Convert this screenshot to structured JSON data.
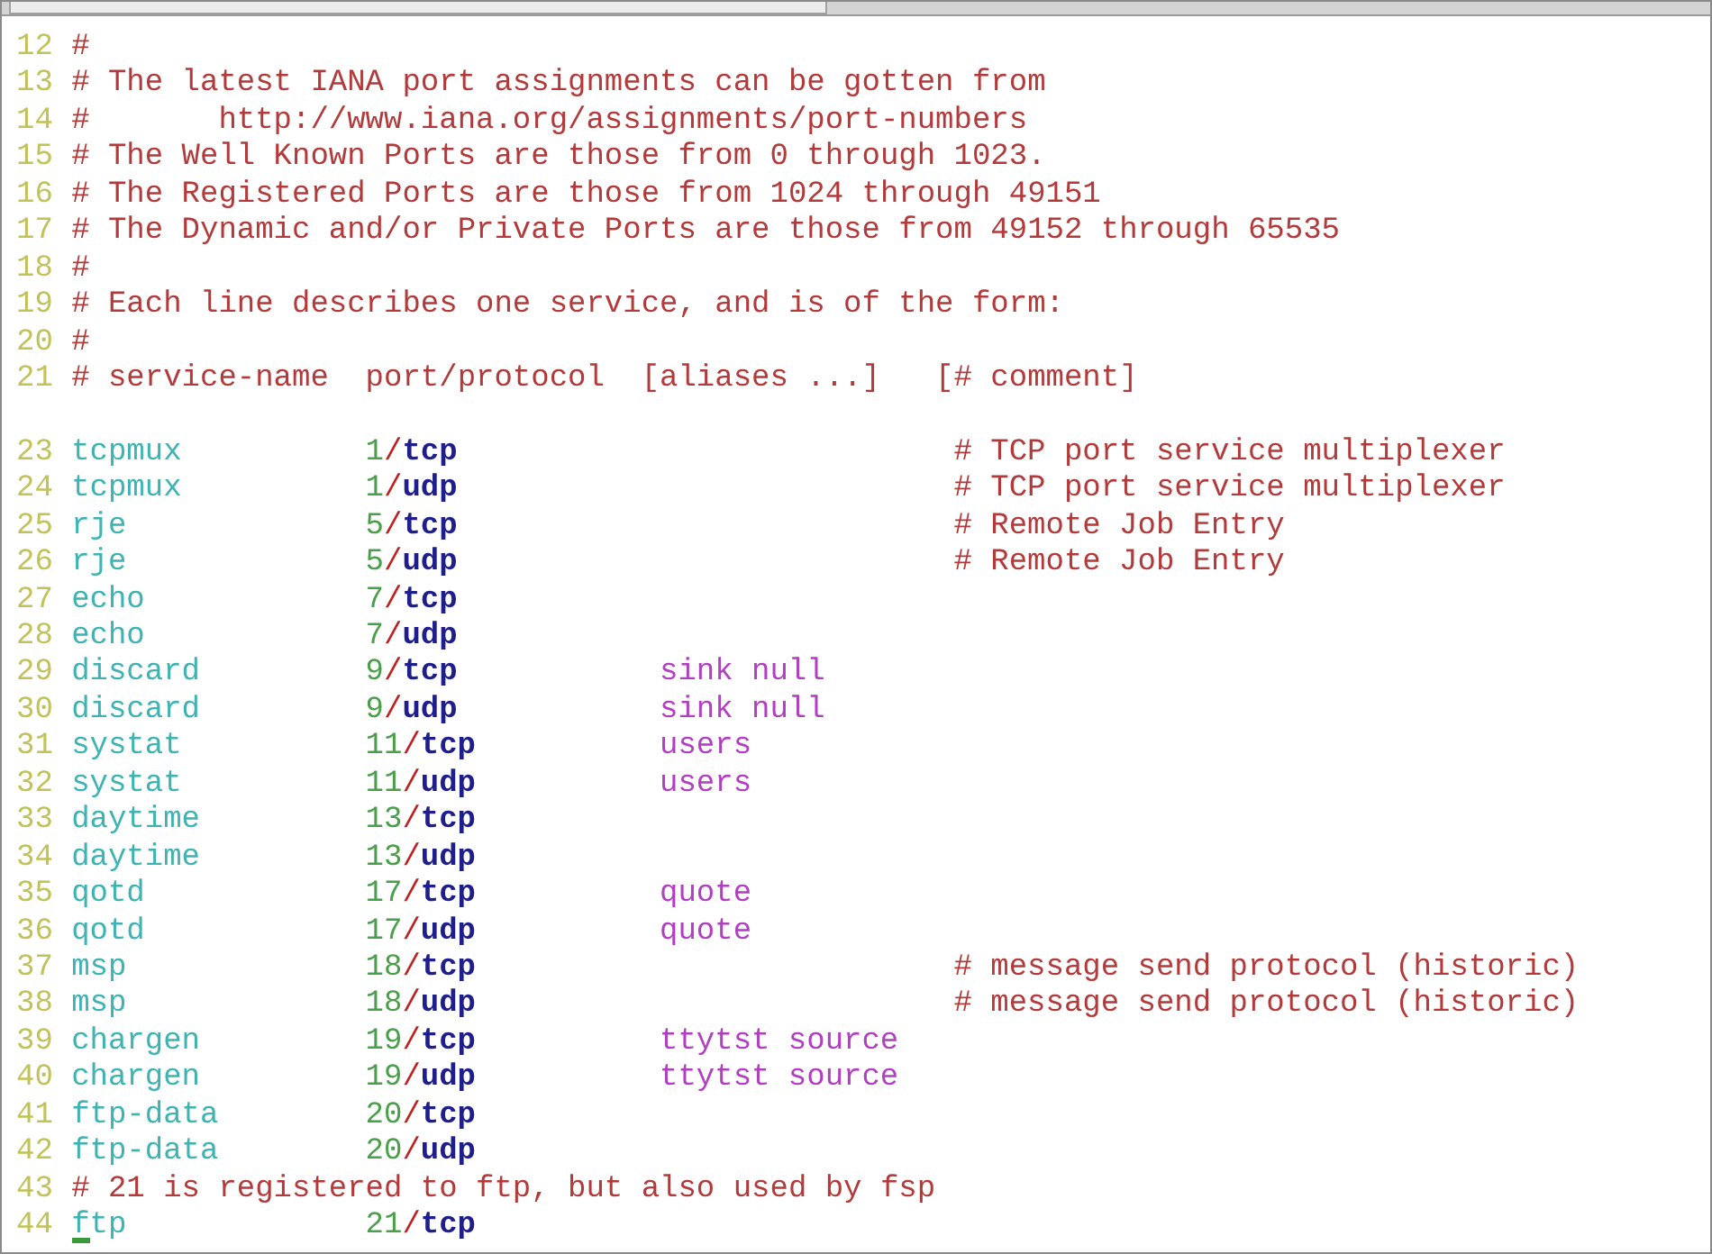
{
  "editor": {
    "lines": [
      {
        "kind": "comment",
        "number": "12",
        "text": "#"
      },
      {
        "kind": "comment",
        "number": "13",
        "text": "# The latest IANA port assignments can be gotten from"
      },
      {
        "kind": "comment",
        "number": "14",
        "text": "#       http://www.iana.org/assignments/port-numbers"
      },
      {
        "kind": "comment",
        "number": "15",
        "text": "# The Well Known Ports are those from 0 through 1023."
      },
      {
        "kind": "comment",
        "number": "16",
        "text": "# The Registered Ports are those from 1024 through 49151"
      },
      {
        "kind": "comment",
        "number": "17",
        "text": "# The Dynamic and/or Private Ports are those from 49152 through 65535"
      },
      {
        "kind": "comment",
        "number": "18",
        "text": "#"
      },
      {
        "kind": "comment",
        "number": "19",
        "text": "# Each line describes one service, and is of the form:"
      },
      {
        "kind": "comment",
        "number": "20",
        "text": "#"
      },
      {
        "kind": "comment",
        "number": "21",
        "text": "# service-name  port/protocol  [aliases ...]   [# comment]"
      },
      {
        "kind": "blank"
      },
      {
        "kind": "service",
        "number": "23",
        "name": "tcpmux",
        "port": "1/tcp",
        "comment": "# TCP port service multiplexer"
      },
      {
        "kind": "service",
        "number": "24",
        "name": "tcpmux",
        "port": "1/udp",
        "comment": "# TCP port service multiplexer"
      },
      {
        "kind": "service",
        "number": "25",
        "name": "rje",
        "port": "5/tcp",
        "comment": "# Remote Job Entry"
      },
      {
        "kind": "service",
        "number": "26",
        "name": "rje",
        "port": "5/udp",
        "comment": "# Remote Job Entry"
      },
      {
        "kind": "service",
        "number": "27",
        "name": "echo",
        "port": "7/tcp"
      },
      {
        "kind": "service",
        "number": "28",
        "name": "echo",
        "port": "7/udp"
      },
      {
        "kind": "service",
        "number": "29",
        "name": "discard",
        "port": "9/tcp",
        "aliases": "sink null"
      },
      {
        "kind": "service",
        "number": "30",
        "name": "discard",
        "port": "9/udp",
        "aliases": "sink null"
      },
      {
        "kind": "service",
        "number": "31",
        "name": "systat",
        "port": "11/tcp",
        "aliases": "users"
      },
      {
        "kind": "service",
        "number": "32",
        "name": "systat",
        "port": "11/udp",
        "aliases": "users"
      },
      {
        "kind": "service",
        "number": "33",
        "name": "daytime",
        "port": "13/tcp"
      },
      {
        "kind": "service",
        "number": "34",
        "name": "daytime",
        "port": "13/udp"
      },
      {
        "kind": "service",
        "number": "35",
        "name": "qotd",
        "port": "17/tcp",
        "aliases": "quote"
      },
      {
        "kind": "service",
        "number": "36",
        "name": "qotd",
        "port": "17/udp",
        "aliases": "quote"
      },
      {
        "kind": "service",
        "number": "37",
        "name": "msp",
        "port": "18/tcp",
        "comment": "# message send protocol (historic)"
      },
      {
        "kind": "service",
        "number": "38",
        "name": "msp",
        "port": "18/udp",
        "comment": "# message send protocol (historic)"
      },
      {
        "kind": "service",
        "number": "39",
        "name": "chargen",
        "port": "19/tcp",
        "aliases": "ttytst source"
      },
      {
        "kind": "service",
        "number": "40",
        "name": "chargen",
        "port": "19/udp",
        "aliases": "ttytst source"
      },
      {
        "kind": "service",
        "number": "41",
        "name": "ftp-data",
        "port": "20/tcp"
      },
      {
        "kind": "service",
        "number": "42",
        "name": "ftp-data",
        "port": "20/udp"
      },
      {
        "kind": "comment",
        "number": "43",
        "text": "# 21 is registered to ftp, but also used by fsp"
      },
      {
        "kind": "service",
        "number": "44",
        "name": "ftp",
        "port": "21/tcp",
        "cursor": true
      }
    ]
  }
}
